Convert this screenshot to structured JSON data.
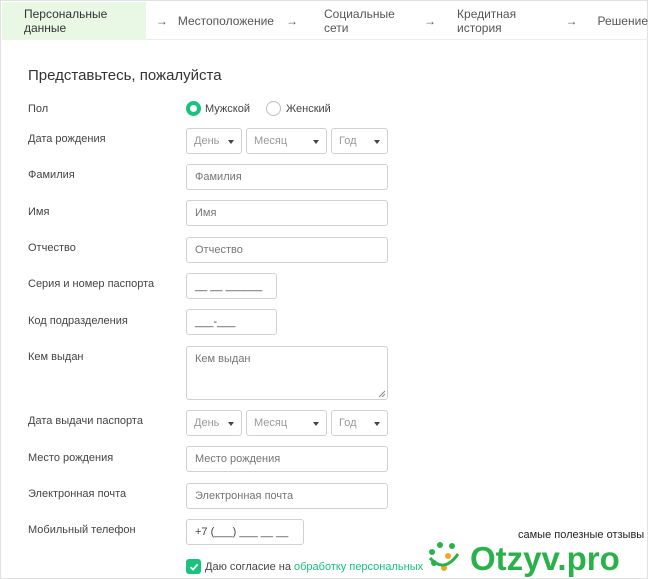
{
  "steps": [
    {
      "label": "Персональные данные",
      "active": true
    },
    {
      "label": "Местоположение",
      "active": false
    },
    {
      "label": "Социальные сети",
      "active": false
    },
    {
      "label": "Кредитная история",
      "active": false
    },
    {
      "label": "Решение",
      "active": false
    }
  ],
  "step_separator": "→",
  "form": {
    "title": "Представьтесь, пожалуйста",
    "gender": {
      "label": "Пол",
      "options": [
        "Мужской",
        "Женский"
      ],
      "selected": "Мужской"
    },
    "birth_date": {
      "label": "Дата рождения",
      "day": "День",
      "month": "Месяц",
      "year": "Год"
    },
    "last_name": {
      "label": "Фамилия",
      "placeholder": "Фамилия"
    },
    "first_name": {
      "label": "Имя",
      "placeholder": "Имя"
    },
    "patronymic": {
      "label": "Отчество",
      "placeholder": "Отчество"
    },
    "passport_number": {
      "label": "Серия и номер паспорта",
      "value": "__ __ ______"
    },
    "division_code": {
      "label": "Код подразделения",
      "value": "___-___"
    },
    "issued_by": {
      "label": "Кем выдан",
      "placeholder": "Кем выдан"
    },
    "issue_date": {
      "label": "Дата выдачи паспорта",
      "day": "День",
      "month": "Месяц",
      "year": "Год"
    },
    "birth_place": {
      "label": "Место рождения",
      "placeholder": "Место рождения"
    },
    "email": {
      "label": "Электронная почта",
      "placeholder": "Электронная почта"
    },
    "phone": {
      "label": "Мобильный телефон",
      "value": "+7 (___) ___ __ __"
    },
    "consent": {
      "prefix": "Даю согласие на ",
      "link": "обработку персональных данных",
      "checked": true
    }
  },
  "watermark": {
    "tagline": "самые полезные отзывы",
    "logo_text": "Otzyv.pro"
  },
  "colors": {
    "accent": "#19c37d",
    "active_step_bg": "#e8f8e5",
    "watermark_green": "#2ab24a"
  }
}
